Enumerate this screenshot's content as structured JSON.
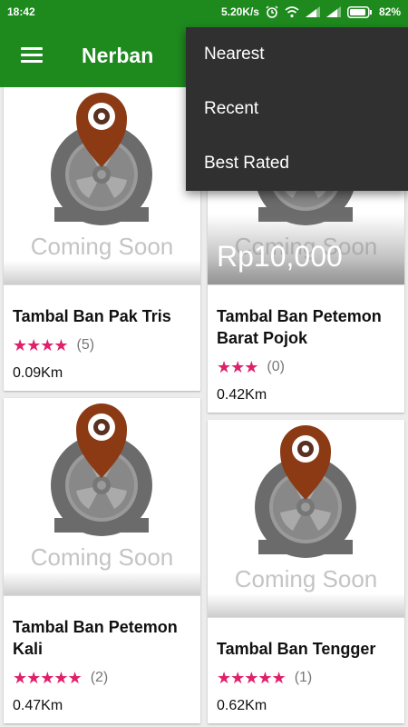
{
  "status_bar": {
    "time": "18:42",
    "network_speed": "5.20K/s",
    "battery": "82%",
    "icons": [
      "alarm-icon",
      "wifi-icon",
      "signal-icon",
      "signal-icon",
      "battery-icon"
    ]
  },
  "app_bar": {
    "title": "Nerban",
    "menu_icon": "hamburger-menu-icon"
  },
  "sort_menu": {
    "items": [
      "Nearest",
      "Recent",
      "Best Rated"
    ]
  },
  "cards": [
    {
      "title": "Tambal Ban Pak Tris",
      "image_text": "Coming Soon",
      "price": "",
      "rating": 4,
      "reviews": "(5)",
      "distance": "0.09Km"
    },
    {
      "title": "Tambal Ban Petemon Barat Pojok",
      "image_text": "Coming Soon",
      "price": "Rp10,000",
      "rating": 3,
      "reviews": "(0)",
      "distance": "0.42Km"
    },
    {
      "title": "Tambal Ban Petemon Kali",
      "image_text": "Coming Soon",
      "price": "",
      "rating": 5,
      "reviews": "(2)",
      "distance": "0.47Km"
    },
    {
      "title": "Tambal Ban Tengger",
      "image_text": "Coming Soon",
      "price": "",
      "rating": 5,
      "reviews": "(1)",
      "distance": "0.62Km"
    }
  ],
  "colors": {
    "primary": "#1e8a1e",
    "star": "#e0206a",
    "menu_bg": "#303030",
    "pin": "#8b3a14",
    "tire": "#6b6b6b"
  }
}
